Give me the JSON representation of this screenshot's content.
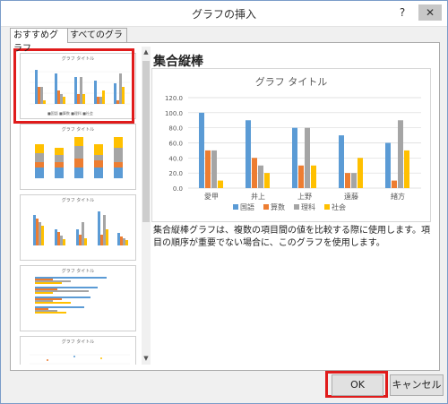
{
  "window": {
    "title": "グラフの挿入",
    "help": "?",
    "close": "✕"
  },
  "tabs": [
    "おすすめグラフ",
    "すべてのグラフ"
  ],
  "thumbnails": [
    {
      "title": "グラフ タイトル",
      "kind": "clustered"
    },
    {
      "title": "グラフ タイトル",
      "kind": "stacked"
    },
    {
      "title": "グラフ タイトル",
      "kind": "clustered-by-subject"
    },
    {
      "title": "グラフ タイトル",
      "kind": "bar"
    },
    {
      "title": "グラフ タイトル",
      "kind": "scatter"
    }
  ],
  "detail": {
    "title": "集合縦棒",
    "description": "集合縦棒グラフは、複数の項目間の値を比較する際に使用します。項目の順序が重要でない場合に、このグラフを使用します。"
  },
  "colors": {
    "s1": "#5b9bd5",
    "s2": "#ed7d31",
    "s3": "#a5a5a5",
    "s4": "#ffc000"
  },
  "chart_data": {
    "type": "bar",
    "title": "グラフ タイトル",
    "categories": [
      "愛甲",
      "井上",
      "上野",
      "遠藤",
      "緒方"
    ],
    "series": [
      {
        "name": "国語",
        "values": [
          100,
          90,
          80,
          70,
          60
        ]
      },
      {
        "name": "算数",
        "values": [
          50,
          40,
          30,
          20,
          10
        ]
      },
      {
        "name": "理科",
        "values": [
          50,
          30,
          80,
          20,
          90
        ]
      },
      {
        "name": "社会",
        "values": [
          10,
          20,
          30,
          40,
          50
        ]
      }
    ],
    "ylim": [
      0,
      120
    ],
    "yticks": [
      "0.0",
      "20.0",
      "40.0",
      "60.0",
      "80.0",
      "100.0",
      "120.0"
    ],
    "legend": "bottom",
    "grid": true
  },
  "buttons": {
    "ok": "OK",
    "cancel": "キャンセル"
  }
}
